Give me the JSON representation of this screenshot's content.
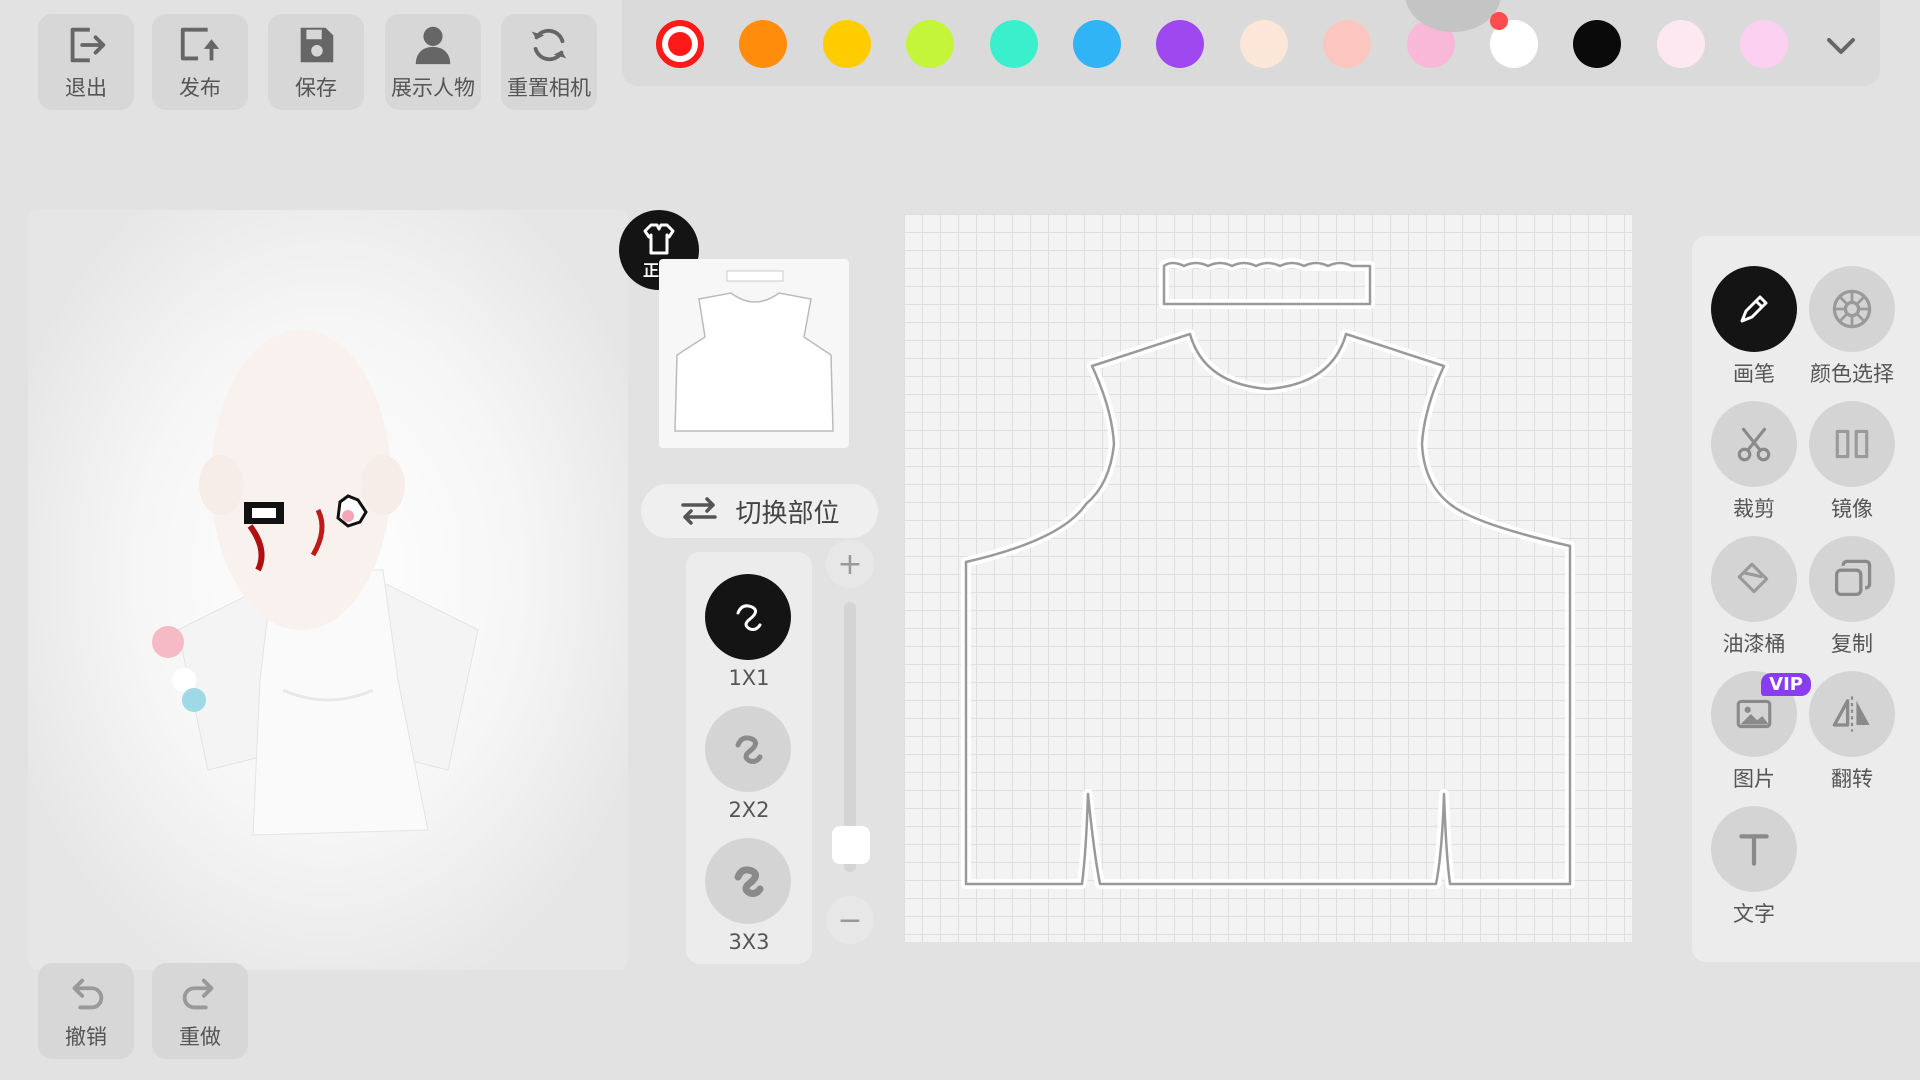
{
  "toolbar": {
    "exit": "退出",
    "publish": "发布",
    "save": "保存",
    "show_character": "展示人物",
    "reset_camera": "重置相机"
  },
  "history": {
    "undo": "撤销",
    "redo": "重做"
  },
  "palette": {
    "selected": "#ff1a1a",
    "colors": [
      "#ff1a1a",
      "#ff8c0a",
      "#ffcc00",
      "#c5f53a",
      "#3af0cc",
      "#30b4f5",
      "#a048f0",
      "#fbe6d8",
      "#fcc6c0",
      "#f9b8d8",
      "#ffffff",
      "#0a0a0a",
      "#fde8f2",
      "#fbd0f0"
    ],
    "more_icon": "chevron-down-icon"
  },
  "view": {
    "label": "正面",
    "icon": "shirt-icon"
  },
  "part_switch": {
    "label": "切换部位",
    "icon": "swap-arrows-icon"
  },
  "brush_sizes": {
    "selected": "1X1",
    "items": [
      {
        "label": "1X1"
      },
      {
        "label": "2X2"
      },
      {
        "label": "3X3"
      }
    ]
  },
  "zoom": {
    "plus": "+",
    "minus": "−",
    "level": 0.1
  },
  "tools": {
    "selected": "画笔",
    "brush": "画笔",
    "color_picker": "颜色选择",
    "crop": "裁剪",
    "mirror": "镜像",
    "paint_bucket": "油漆桶",
    "copy": "复制",
    "image": "图片",
    "image_badge": "VIP",
    "flip": "翻转",
    "text": "文字"
  }
}
